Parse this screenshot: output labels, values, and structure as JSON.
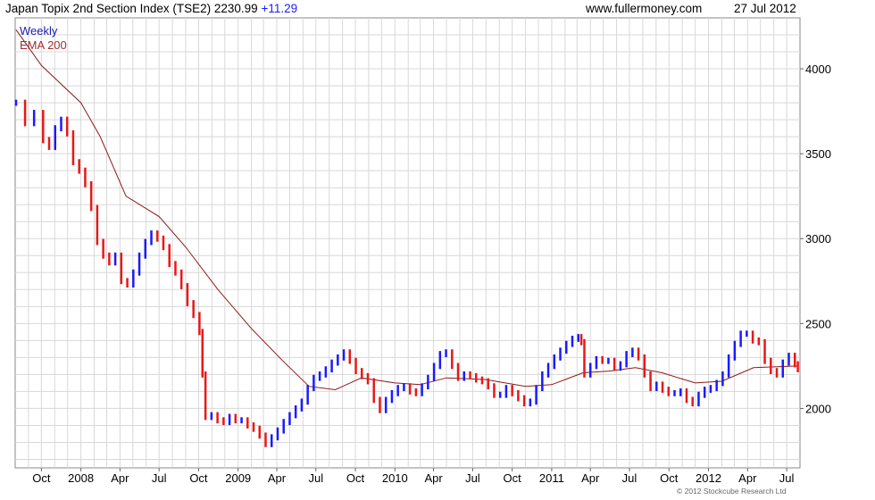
{
  "header": {
    "title": "Japan Topix 2nd Section Index (TSE2) 2230.99",
    "change": "+11.29",
    "site": "www.fullermoney.com",
    "date": "27 Jul 2012"
  },
  "footer": {
    "copyright": "© 2012 Stockcube Research Ltd"
  },
  "colors": {
    "up": "#1a1aff",
    "down": "#e81818",
    "ema": "#8b1a1a",
    "grid": "#d8d8d8"
  },
  "chart_data": {
    "type": "line",
    "ylim": [
      1650,
      4300
    ],
    "yticks": [
      2000,
      2500,
      3000,
      3500,
      4000
    ],
    "ytick_labels": [
      "2000",
      "2500",
      "3000",
      "3500",
      "4000"
    ],
    "xticks": [
      {
        "label": "Oct",
        "x": "2007-10-01"
      },
      {
        "label": "2008",
        "x": "2008-01-01"
      },
      {
        "label": "Apr",
        "x": "2008-04-01"
      },
      {
        "label": "Jul",
        "x": "2008-07-01"
      },
      {
        "label": "Oct",
        "x": "2008-10-01"
      },
      {
        "label": "2009",
        "x": "2009-01-01"
      },
      {
        "label": "Apr",
        "x": "2009-04-01"
      },
      {
        "label": "Jul",
        "x": "2009-07-01"
      },
      {
        "label": "Oct",
        "x": "2009-10-01"
      },
      {
        "label": "2010",
        "x": "2010-01-01"
      },
      {
        "label": "Apr",
        "x": "2010-04-01"
      },
      {
        "label": "Jul",
        "x": "2010-07-01"
      },
      {
        "label": "Oct",
        "x": "2010-10-01"
      },
      {
        "label": "2011",
        "x": "2011-01-01"
      },
      {
        "label": "Apr",
        "x": "2011-04-01"
      },
      {
        "label": "Jul",
        "x": "2011-07-01"
      },
      {
        "label": "Oct",
        "x": "2011-10-01"
      },
      {
        "label": "2012",
        "x": "2012-01-01"
      },
      {
        "label": "Apr",
        "x": "2012-04-01"
      },
      {
        "label": "Jul",
        "x": "2012-07-01"
      }
    ],
    "xlim": [
      "2007-08-01",
      "2012-08-01"
    ],
    "grid": true,
    "legend": [
      "Weekly",
      "EMA 200"
    ],
    "series": [
      {
        "name": "Weekly",
        "points": [
          [
            "2007-08-03",
            3800
          ],
          [
            "2007-08-24",
            3680
          ],
          [
            "2007-09-14",
            3740
          ],
          [
            "2007-10-05",
            3580
          ],
          [
            "2007-10-19",
            3540
          ],
          [
            "2007-11-02",
            3650
          ],
          [
            "2007-11-16",
            3700
          ],
          [
            "2007-11-30",
            3620
          ],
          [
            "2007-12-14",
            3450
          ],
          [
            "2007-12-28",
            3400
          ],
          [
            "2008-01-11",
            3320
          ],
          [
            "2008-01-25",
            3180
          ],
          [
            "2008-02-08",
            2980
          ],
          [
            "2008-02-22",
            2900
          ],
          [
            "2008-03-07",
            2860
          ],
          [
            "2008-03-21",
            2900
          ],
          [
            "2008-04-04",
            2750
          ],
          [
            "2008-04-18",
            2730
          ],
          [
            "2008-05-02",
            2800
          ],
          [
            "2008-05-16",
            2900
          ],
          [
            "2008-05-30",
            2980
          ],
          [
            "2008-06-13",
            3030
          ],
          [
            "2008-06-27",
            3000
          ],
          [
            "2008-07-11",
            2950
          ],
          [
            "2008-07-25",
            2850
          ],
          [
            "2008-08-08",
            2800
          ],
          [
            "2008-08-22",
            2720
          ],
          [
            "2008-09-05",
            2620
          ],
          [
            "2008-09-19",
            2550
          ],
          [
            "2008-10-03",
            2450
          ],
          [
            "2008-10-10",
            2200
          ],
          [
            "2008-10-17",
            1950
          ],
          [
            "2008-10-31",
            1960
          ],
          [
            "2008-11-14",
            1930
          ],
          [
            "2008-11-28",
            1920
          ],
          [
            "2008-12-12",
            1950
          ],
          [
            "2008-12-26",
            1930
          ],
          [
            "2009-01-09",
            1930
          ],
          [
            "2009-01-23",
            1900
          ],
          [
            "2009-02-06",
            1880
          ],
          [
            "2009-02-20",
            1840
          ],
          [
            "2009-03-06",
            1790
          ],
          [
            "2009-03-20",
            1830
          ],
          [
            "2009-04-03",
            1870
          ],
          [
            "2009-04-17",
            1920
          ],
          [
            "2009-05-01",
            1960
          ],
          [
            "2009-05-15",
            2000
          ],
          [
            "2009-05-29",
            2040
          ],
          [
            "2009-06-12",
            2120
          ],
          [
            "2009-06-26",
            2180
          ],
          [
            "2009-07-10",
            2200
          ],
          [
            "2009-07-24",
            2230
          ],
          [
            "2009-08-07",
            2270
          ],
          [
            "2009-08-21",
            2300
          ],
          [
            "2009-09-04",
            2330
          ],
          [
            "2009-09-18",
            2280
          ],
          [
            "2009-10-02",
            2220
          ],
          [
            "2009-10-16",
            2190
          ],
          [
            "2009-10-30",
            2160
          ],
          [
            "2009-11-13",
            2050
          ],
          [
            "2009-11-27",
            1990
          ],
          [
            "2009-12-11",
            2050
          ],
          [
            "2009-12-25",
            2090
          ],
          [
            "2010-01-08",
            2120
          ],
          [
            "2010-01-22",
            2130
          ],
          [
            "2010-02-05",
            2100
          ],
          [
            "2010-02-19",
            2090
          ],
          [
            "2010-03-05",
            2130
          ],
          [
            "2010-03-19",
            2180
          ],
          [
            "2010-04-02",
            2250
          ],
          [
            "2010-04-16",
            2320
          ],
          [
            "2010-04-30",
            2330
          ],
          [
            "2010-05-14",
            2250
          ],
          [
            "2010-05-28",
            2180
          ],
          [
            "2010-06-11",
            2200
          ],
          [
            "2010-06-25",
            2190
          ],
          [
            "2010-07-09",
            2170
          ],
          [
            "2010-07-23",
            2160
          ],
          [
            "2010-08-06",
            2130
          ],
          [
            "2010-08-20",
            2080
          ],
          [
            "2010-09-03",
            2080
          ],
          [
            "2010-09-17",
            2120
          ],
          [
            "2010-10-01",
            2090
          ],
          [
            "2010-10-15",
            2060
          ],
          [
            "2010-10-29",
            2030
          ],
          [
            "2010-11-12",
            2040
          ],
          [
            "2010-11-26",
            2120
          ],
          [
            "2010-12-10",
            2200
          ],
          [
            "2010-12-24",
            2250
          ],
          [
            "2011-01-07",
            2300
          ],
          [
            "2011-01-21",
            2340
          ],
          [
            "2011-02-04",
            2380
          ],
          [
            "2011-02-18",
            2410
          ],
          [
            "2011-03-04",
            2420
          ],
          [
            "2011-03-11",
            2390
          ],
          [
            "2011-03-18",
            2200
          ],
          [
            "2011-04-01",
            2250
          ],
          [
            "2011-04-15",
            2290
          ],
          [
            "2011-04-29",
            2280
          ],
          [
            "2011-05-13",
            2280
          ],
          [
            "2011-05-27",
            2240
          ],
          [
            "2011-06-10",
            2260
          ],
          [
            "2011-06-24",
            2320
          ],
          [
            "2011-07-08",
            2340
          ],
          [
            "2011-07-22",
            2300
          ],
          [
            "2011-08-05",
            2200
          ],
          [
            "2011-08-19",
            2120
          ],
          [
            "2011-09-02",
            2140
          ],
          [
            "2011-09-16",
            2110
          ],
          [
            "2011-09-30",
            2090
          ],
          [
            "2011-10-14",
            2090
          ],
          [
            "2011-10-28",
            2100
          ],
          [
            "2011-11-11",
            2050
          ],
          [
            "2011-11-25",
            2030
          ],
          [
            "2011-12-09",
            2080
          ],
          [
            "2011-12-23",
            2110
          ],
          [
            "2012-01-06",
            2120
          ],
          [
            "2012-01-20",
            2150
          ],
          [
            "2012-02-03",
            2200
          ],
          [
            "2012-02-17",
            2300
          ],
          [
            "2012-03-02",
            2380
          ],
          [
            "2012-03-16",
            2440
          ],
          [
            "2012-03-30",
            2440
          ],
          [
            "2012-04-13",
            2400
          ],
          [
            "2012-04-27",
            2390
          ],
          [
            "2012-05-11",
            2280
          ],
          [
            "2012-05-25",
            2220
          ],
          [
            "2012-06-08",
            2200
          ],
          [
            "2012-06-22",
            2270
          ],
          [
            "2012-07-06",
            2310
          ],
          [
            "2012-07-20",
            2260
          ],
          [
            "2012-07-27",
            2231
          ]
        ]
      },
      {
        "name": "EMA 200",
        "points": [
          [
            "2007-08-03",
            4230
          ],
          [
            "2007-10-01",
            4020
          ],
          [
            "2008-01-01",
            3800
          ],
          [
            "2008-02-15",
            3600
          ],
          [
            "2008-04-15",
            3250
          ],
          [
            "2008-07-01",
            3130
          ],
          [
            "2008-09-01",
            2950
          ],
          [
            "2008-11-15",
            2700
          ],
          [
            "2009-02-01",
            2470
          ],
          [
            "2009-04-15",
            2280
          ],
          [
            "2009-06-15",
            2130
          ],
          [
            "2009-08-15",
            2110
          ],
          [
            "2009-10-15",
            2180
          ],
          [
            "2010-01-01",
            2150
          ],
          [
            "2010-03-01",
            2140
          ],
          [
            "2010-05-01",
            2180
          ],
          [
            "2010-08-01",
            2170
          ],
          [
            "2010-11-01",
            2130
          ],
          [
            "2011-01-01",
            2140
          ],
          [
            "2011-03-15",
            2210
          ],
          [
            "2011-05-15",
            2220
          ],
          [
            "2011-07-15",
            2240
          ],
          [
            "2011-09-15",
            2210
          ],
          [
            "2011-12-01",
            2150
          ],
          [
            "2012-02-01",
            2160
          ],
          [
            "2012-04-15",
            2240
          ],
          [
            "2012-07-27",
            2250
          ]
        ]
      }
    ]
  }
}
